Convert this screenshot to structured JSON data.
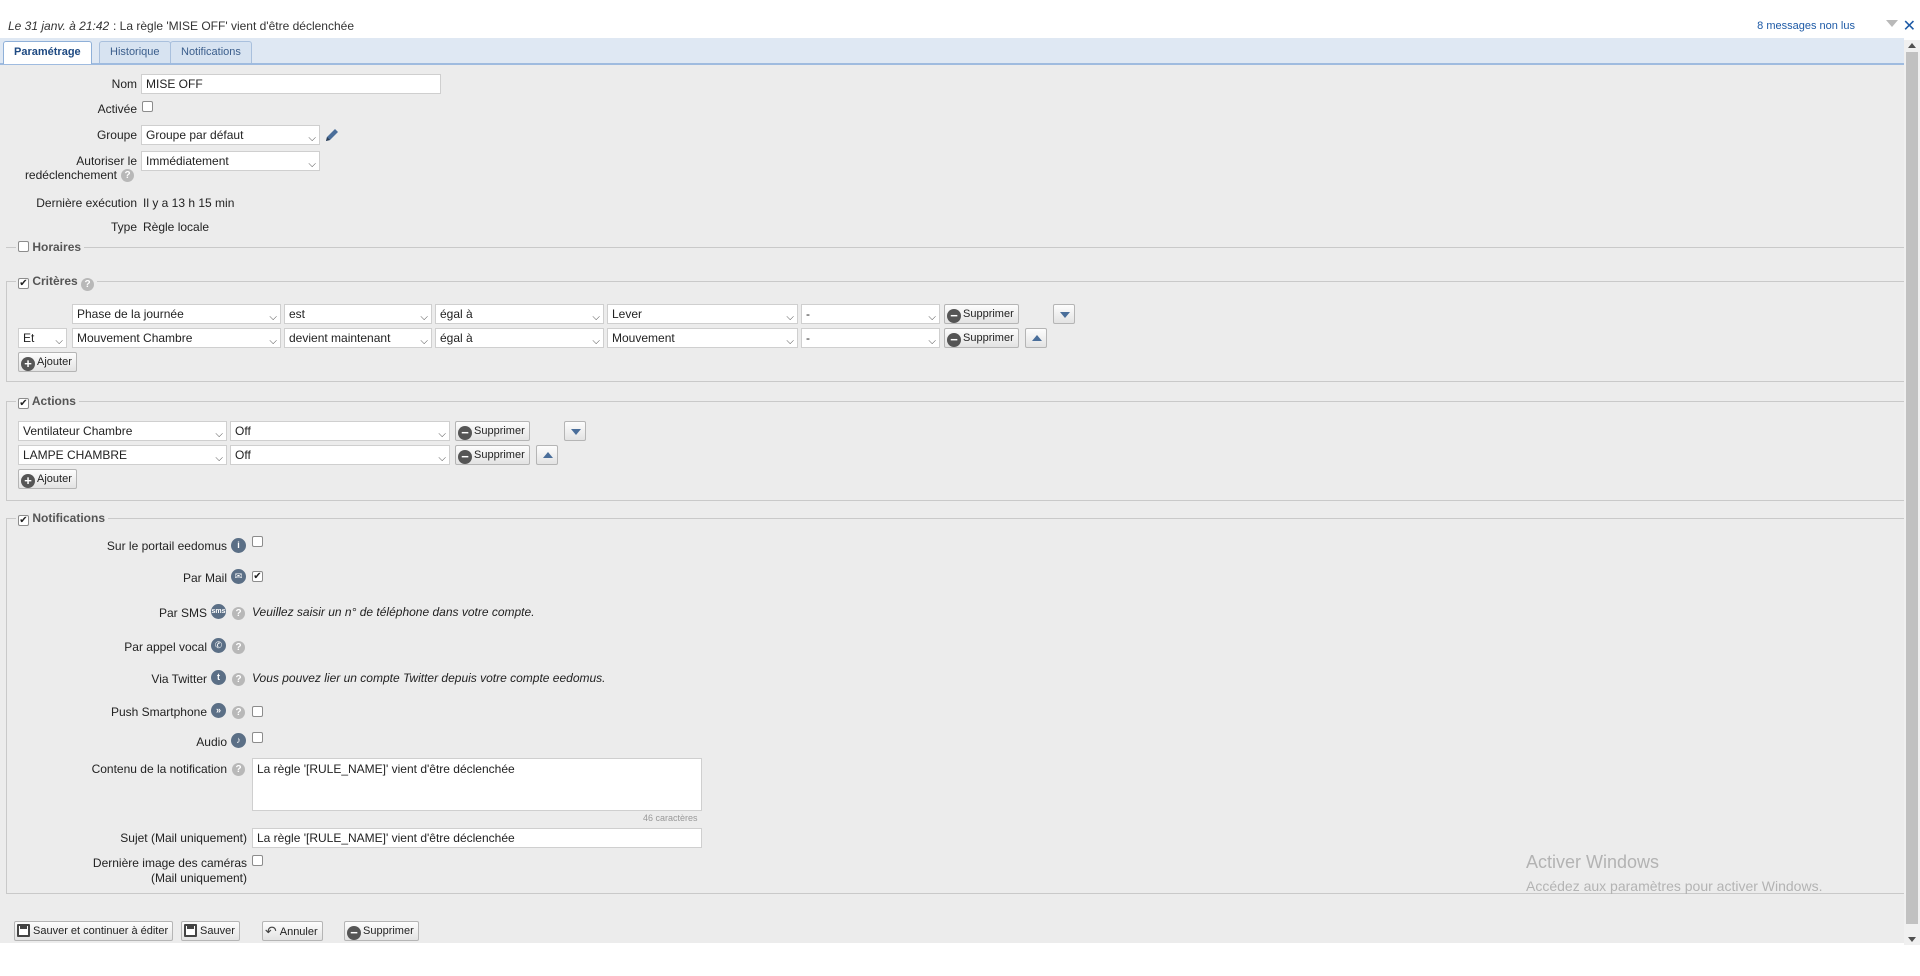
{
  "message_bar": {
    "time": "Le 31 janv. à 21:42",
    "message": ": La règle 'MISE OFF' vient d'être déclenchée",
    "unread": "8 messages non lus",
    "close": "✕"
  },
  "tabs": [
    "Paramétrage",
    "Historique",
    "Notifications"
  ],
  "general": {
    "nom_label": "Nom",
    "nom_value": "MISE OFF",
    "activee_label": "Activée",
    "groupe_label": "Groupe",
    "groupe_value": "Groupe par défaut",
    "autoriser_label_1": "Autoriser le",
    "autoriser_label_2": "redéclenchement",
    "autoriser_value": "Immédiatement",
    "derniere_label": "Dernière exécution",
    "derniere_value": "Il y a 13 h 15 min",
    "type_label": "Type",
    "type_value": "Règle locale"
  },
  "horaires": {
    "legend": "Horaires",
    "checked": false
  },
  "criteres": {
    "legend": "Critères",
    "checked": true,
    "rows": [
      {
        "op": "",
        "device": "Phase de la journée",
        "verb": "est",
        "cmp": "égal à",
        "value": "Lever",
        "extra": "-",
        "delete": "Supprimer"
      },
      {
        "op": "Et",
        "device": "Mouvement Chambre",
        "verb": "devient maintenant",
        "cmp": "égal à",
        "value": "Mouvement",
        "extra": "-",
        "delete": "Supprimer"
      }
    ],
    "add": "Ajouter"
  },
  "actions": {
    "legend": "Actions",
    "checked": true,
    "rows": [
      {
        "device": "Ventilateur Chambre",
        "value": "Off",
        "delete": "Supprimer"
      },
      {
        "device": "LAMPE CHAMBRE",
        "value": "Off",
        "delete": "Supprimer"
      }
    ],
    "add": "Ajouter"
  },
  "notifications": {
    "legend": "Notifications",
    "checked": true,
    "portail_label": "Sur le portail eedomus",
    "mail_label": "Par Mail",
    "mail_checked": true,
    "sms_label": "Par SMS",
    "sms_note": "Veuillez saisir un n° de téléphone dans votre compte.",
    "vocal_label": "Par appel vocal",
    "twitter_label": "Via Twitter",
    "twitter_note": "Vous pouvez lier un compte Twitter depuis votre compte eedomus.",
    "push_label": "Push Smartphone",
    "audio_label": "Audio",
    "contenu_label": "Contenu de la notification",
    "contenu_value": "La règle '[RULE_NAME]' vient d'être déclenchée",
    "counter": "46 caractères",
    "sujet_label": "Sujet (Mail uniquement)",
    "sujet_value": "La règle '[RULE_NAME]' vient d'être déclenchée",
    "camera_label_1": "Dernière image des caméras",
    "camera_label_2": "(Mail uniquement)"
  },
  "footer": {
    "save_continue": "Sauver et continuer à éditer",
    "save": "Sauver",
    "cancel": "Annuler",
    "delete": "Supprimer"
  },
  "watermark": {
    "line1": "Activer Windows",
    "line2": "Accédez aux paramètres pour activer Windows."
  },
  "colors": {
    "accent": "#1d5aa6",
    "background": "#ececec",
    "tab_bg": "#dfe8f3"
  }
}
